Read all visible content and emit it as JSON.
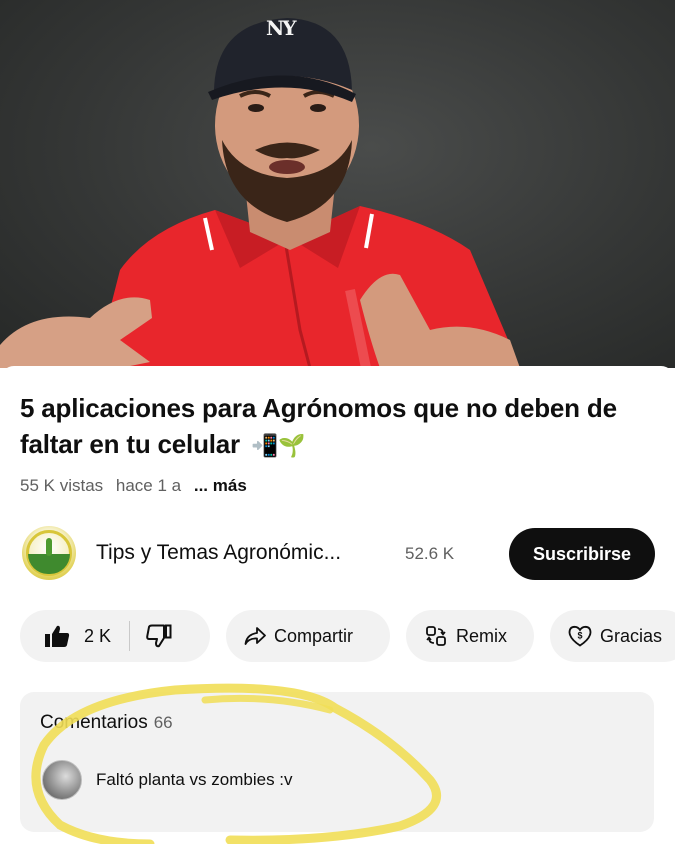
{
  "video": {
    "cap_text": "NY"
  },
  "title": {
    "text": "5 aplicaciones para Agrónomos que no deben de faltar en tu celular",
    "emoji": "📲🌱"
  },
  "meta": {
    "views": "55 K vistas",
    "age": "hace 1 a",
    "more": "... más"
  },
  "channel": {
    "name": "Tips y Temas Agronómic...",
    "subscribers": "52.6 K",
    "subscribe_label": "Suscribirse"
  },
  "actions": {
    "like_count": "2 K",
    "share_label": "Compartir",
    "remix_label": "Remix",
    "thanks_label": "Gracias"
  },
  "comments": {
    "heading": "Comentarios",
    "count": "66",
    "top_comment": "Faltó planta vs zombies :v"
  },
  "colors": {
    "subscribe_bg": "#0f0f0f",
    "pill_bg": "#f2f2f2",
    "highlight": "#f1de57",
    "shirt": "#e8262c"
  }
}
